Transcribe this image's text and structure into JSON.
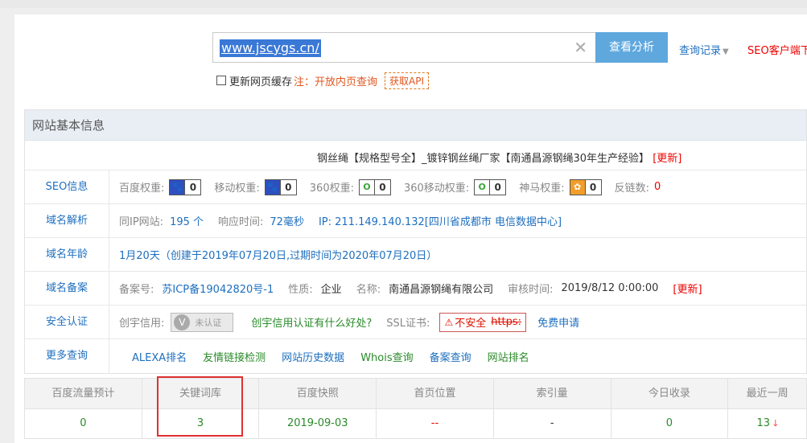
{
  "search": {
    "value": "www.jscygs.cn/",
    "clear_icon": "close-icon",
    "button": "查看分析",
    "history": "查询记录",
    "seo_client": "SEO客户端下"
  },
  "options": {
    "refresh_cache": "更新网页缓存",
    "note": "注：开放内页查询",
    "api": "获取API"
  },
  "panel": {
    "title": "网站基本信息",
    "site_title": "钢丝绳【规格型号全】_镀锌钢丝绳厂家【南通昌源钢绳30年生产经验】",
    "site_title_update": "[更新]",
    "seo": {
      "label": "SEO信息",
      "baidu_label": "百度权重:",
      "baidu_value": "0",
      "mobile_label": "移动权重:",
      "mobile_value": "0",
      "q360_label": "360权重:",
      "q360_value": "0",
      "q360m_label": "360移动权重:",
      "q360m_value": "0",
      "sm_label": "神马权重:",
      "sm_value": "0",
      "backlink_label": "反链数:",
      "backlink_value": "0"
    },
    "dns": {
      "label": "域名解析",
      "same_ip_label": "同IP网站:",
      "same_ip_value": "195 个",
      "resp_label": "响应时间:",
      "resp_value": "72毫秒",
      "ip_text": "IP: 211.149.140.132[四川省成都市 电信数据中心]"
    },
    "age": {
      "label": "域名年龄",
      "value": "1月20天（创建于2019年07月20日,过期时间为2020年07月20日）"
    },
    "record": {
      "label": "域名备案",
      "no_label": "备案号:",
      "no_value": "苏ICP备19042820号-1",
      "nature_label": "性质:",
      "nature_value": "企业",
      "name_label": "名称:",
      "name_value": "南通昌源钢绳有限公司",
      "audit_label": "审核时间:",
      "audit_value": "2019/8/12 0:00:00",
      "update": "[更新]"
    },
    "security": {
      "label": "安全认证",
      "cy_label": "创宇信用:",
      "cert_text": "未认证",
      "cy_link": "创宇信用认证有什么好处?",
      "ssl_label": "SSL证书:",
      "ssl_unsafe": "不安全",
      "ssl_https": "https:",
      "ssl_apply": "免费申请"
    },
    "more": {
      "label": "更多查询",
      "links": [
        "ALEXA排名",
        "友情链接检测",
        "网站历史数据",
        "Whois查询",
        "备案查询",
        "网站排名"
      ]
    }
  },
  "stats": {
    "headers": [
      "百度流量预计",
      "关键词库",
      "百度快照",
      "首页位置",
      "索引量",
      "今日收录",
      "最近一周"
    ],
    "values": [
      "0",
      "3",
      "2019-09-03",
      "--",
      "-",
      "0",
      "13"
    ]
  }
}
